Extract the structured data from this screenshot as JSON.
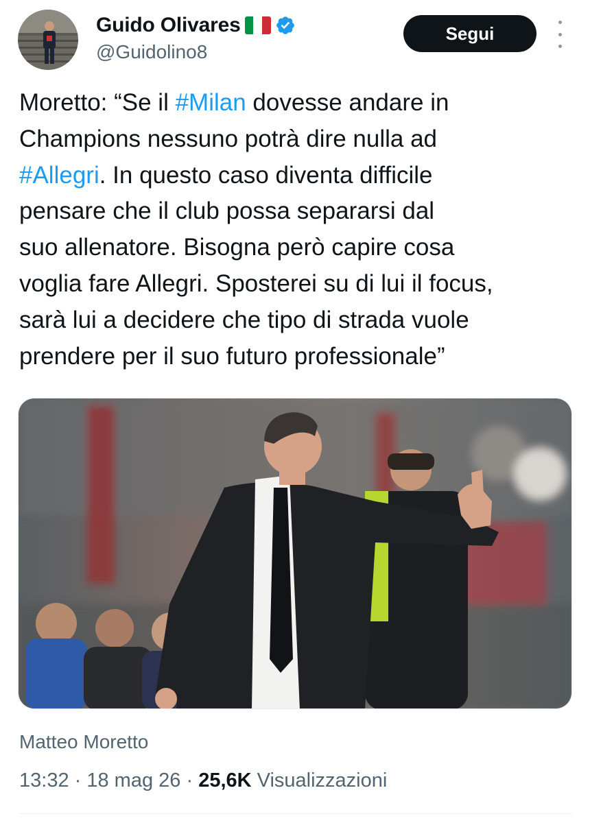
{
  "author": {
    "name": "Guido Olivares",
    "flag_icon": "italy-flag-icon",
    "verified_icon": "verified-badge-icon",
    "handle": "@Guidolino8"
  },
  "actions": {
    "follow_label": "Segui",
    "more_icon": "more-options-icon"
  },
  "tweet": {
    "lines": [
      [
        "Moretto: “Se il ",
        "#Milan",
        " dovesse andare in"
      ],
      [
        "Champions nessuno potrà dire nulla ad"
      ],
      [
        "",
        "#Allegri",
        ". In questo caso diventa difficile"
      ],
      [
        "pensare che il club possa separarsi dal"
      ],
      [
        "suo allenatore. Bisogna però capire cosa"
      ],
      [
        "voglia fare Allegri. Sposterei su di lui il focus,"
      ],
      [
        "sarà lui a decidere che tipo di strada vuole"
      ],
      [
        "prendere per il suo futuro professionale”"
      ]
    ]
  },
  "media": {
    "credit": "Matteo Moretto"
  },
  "meta": {
    "time": "13:32",
    "separator": " · ",
    "date": "18 mag 26",
    "views_count": "25,6K",
    "views_label": " Visualizzazioni"
  },
  "colors": {
    "hashtag": "#1d9bf0",
    "follow_button_bg": "#0f1419",
    "secondary_text": "#536471",
    "verified": "#1d9bf0"
  }
}
